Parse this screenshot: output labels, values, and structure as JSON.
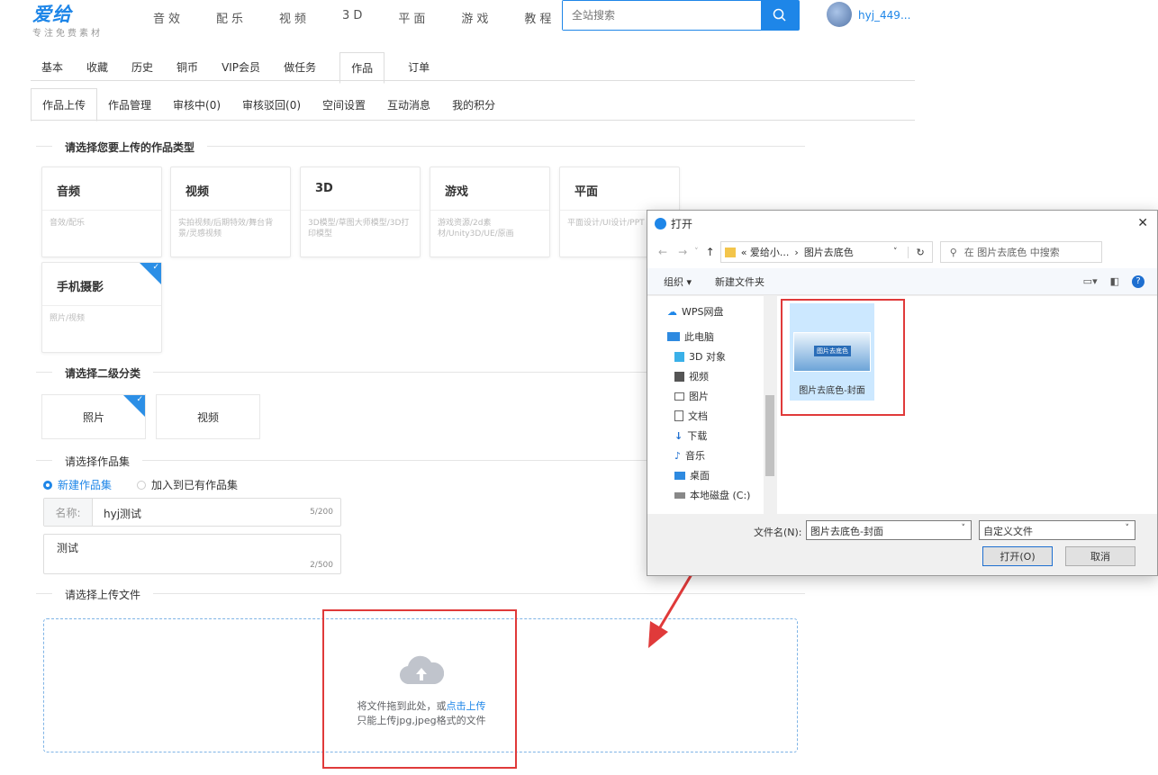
{
  "header": {
    "logo": "爱给",
    "slogan": "专注免费素材",
    "nav": [
      "音效",
      "配乐",
      "视频",
      "3D",
      "平面",
      "游戏",
      "教程"
    ],
    "search_placeholder": "全站搜索",
    "username": "hyj_449..."
  },
  "tabs1": [
    "基本",
    "收藏",
    "历史",
    "铜币",
    "VIP会员",
    "做任务",
    "作品",
    "订单"
  ],
  "tabs2": [
    "作品上传",
    "作品管理",
    "审核中(0)",
    "审核驳回(0)",
    "空间设置",
    "互动消息",
    "我的积分"
  ],
  "section1": "请选择您要上传的作品类型",
  "cards": [
    {
      "title": "音频",
      "desc": "音效/配乐"
    },
    {
      "title": "视频",
      "desc": "实拍视频/后期特效/舞台背景/灵感视频"
    },
    {
      "title": "3D",
      "desc": "3D模型/草图大师模型/3D打印模型"
    },
    {
      "title": "游戏",
      "desc": "游戏资源/2d素材/Unity3D/UE/原画"
    },
    {
      "title": "平面",
      "desc": "平面设计/UI设计/PPT"
    },
    {
      "title": "手机摄影",
      "desc": "照片/视频"
    }
  ],
  "section2": "请选择二级分类",
  "sub": [
    "照片",
    "视频"
  ],
  "section3": "请选择作品集",
  "radios": [
    "新建作品集",
    "加入到已有作品集"
  ],
  "name_label": "名称:",
  "name_value": "hyj测试",
  "name_count": "5/200",
  "desc_value": "测试",
  "desc_count": "2/500",
  "section4": "请选择上传文件",
  "upload_text1": "将文件拖到此处，或",
  "upload_link": "点击上传",
  "upload_text2": "只能上传jpg,jpeg格式的文件",
  "dialog": {
    "title": "打开",
    "breadcrumb": [
      "«  爱给小...",
      "›",
      "图片去底色"
    ],
    "search_placeholder": "在 图片去底色 中搜索",
    "organize": "组织 ▾",
    "new_folder": "新建文件夹",
    "tree": [
      {
        "label": "WPS网盘",
        "icon": "cloud-icon"
      },
      {
        "label": "此电脑",
        "icon": "pc-icon"
      },
      {
        "label": "3D 对象",
        "icon": "cube-icon"
      },
      {
        "label": "视频",
        "icon": "video-icon"
      },
      {
        "label": "图片",
        "icon": "picture-icon"
      },
      {
        "label": "文档",
        "icon": "document-icon"
      },
      {
        "label": "下载",
        "icon": "download-icon"
      },
      {
        "label": "音乐",
        "icon": "music-icon"
      },
      {
        "label": "桌面",
        "icon": "desktop-icon"
      },
      {
        "label": "本地磁盘 (C:)",
        "icon": "disk-icon"
      }
    ],
    "file": "图片去底色-封面",
    "thumb_text": "图片去底色",
    "filename_label": "文件名(N):",
    "filename": "图片去底色-封面",
    "filter": "自定义文件",
    "open": "打开(O)",
    "cancel": "取消"
  },
  "colors": {
    "accent": "#1e86e8",
    "annotation": "#e03a3a"
  }
}
